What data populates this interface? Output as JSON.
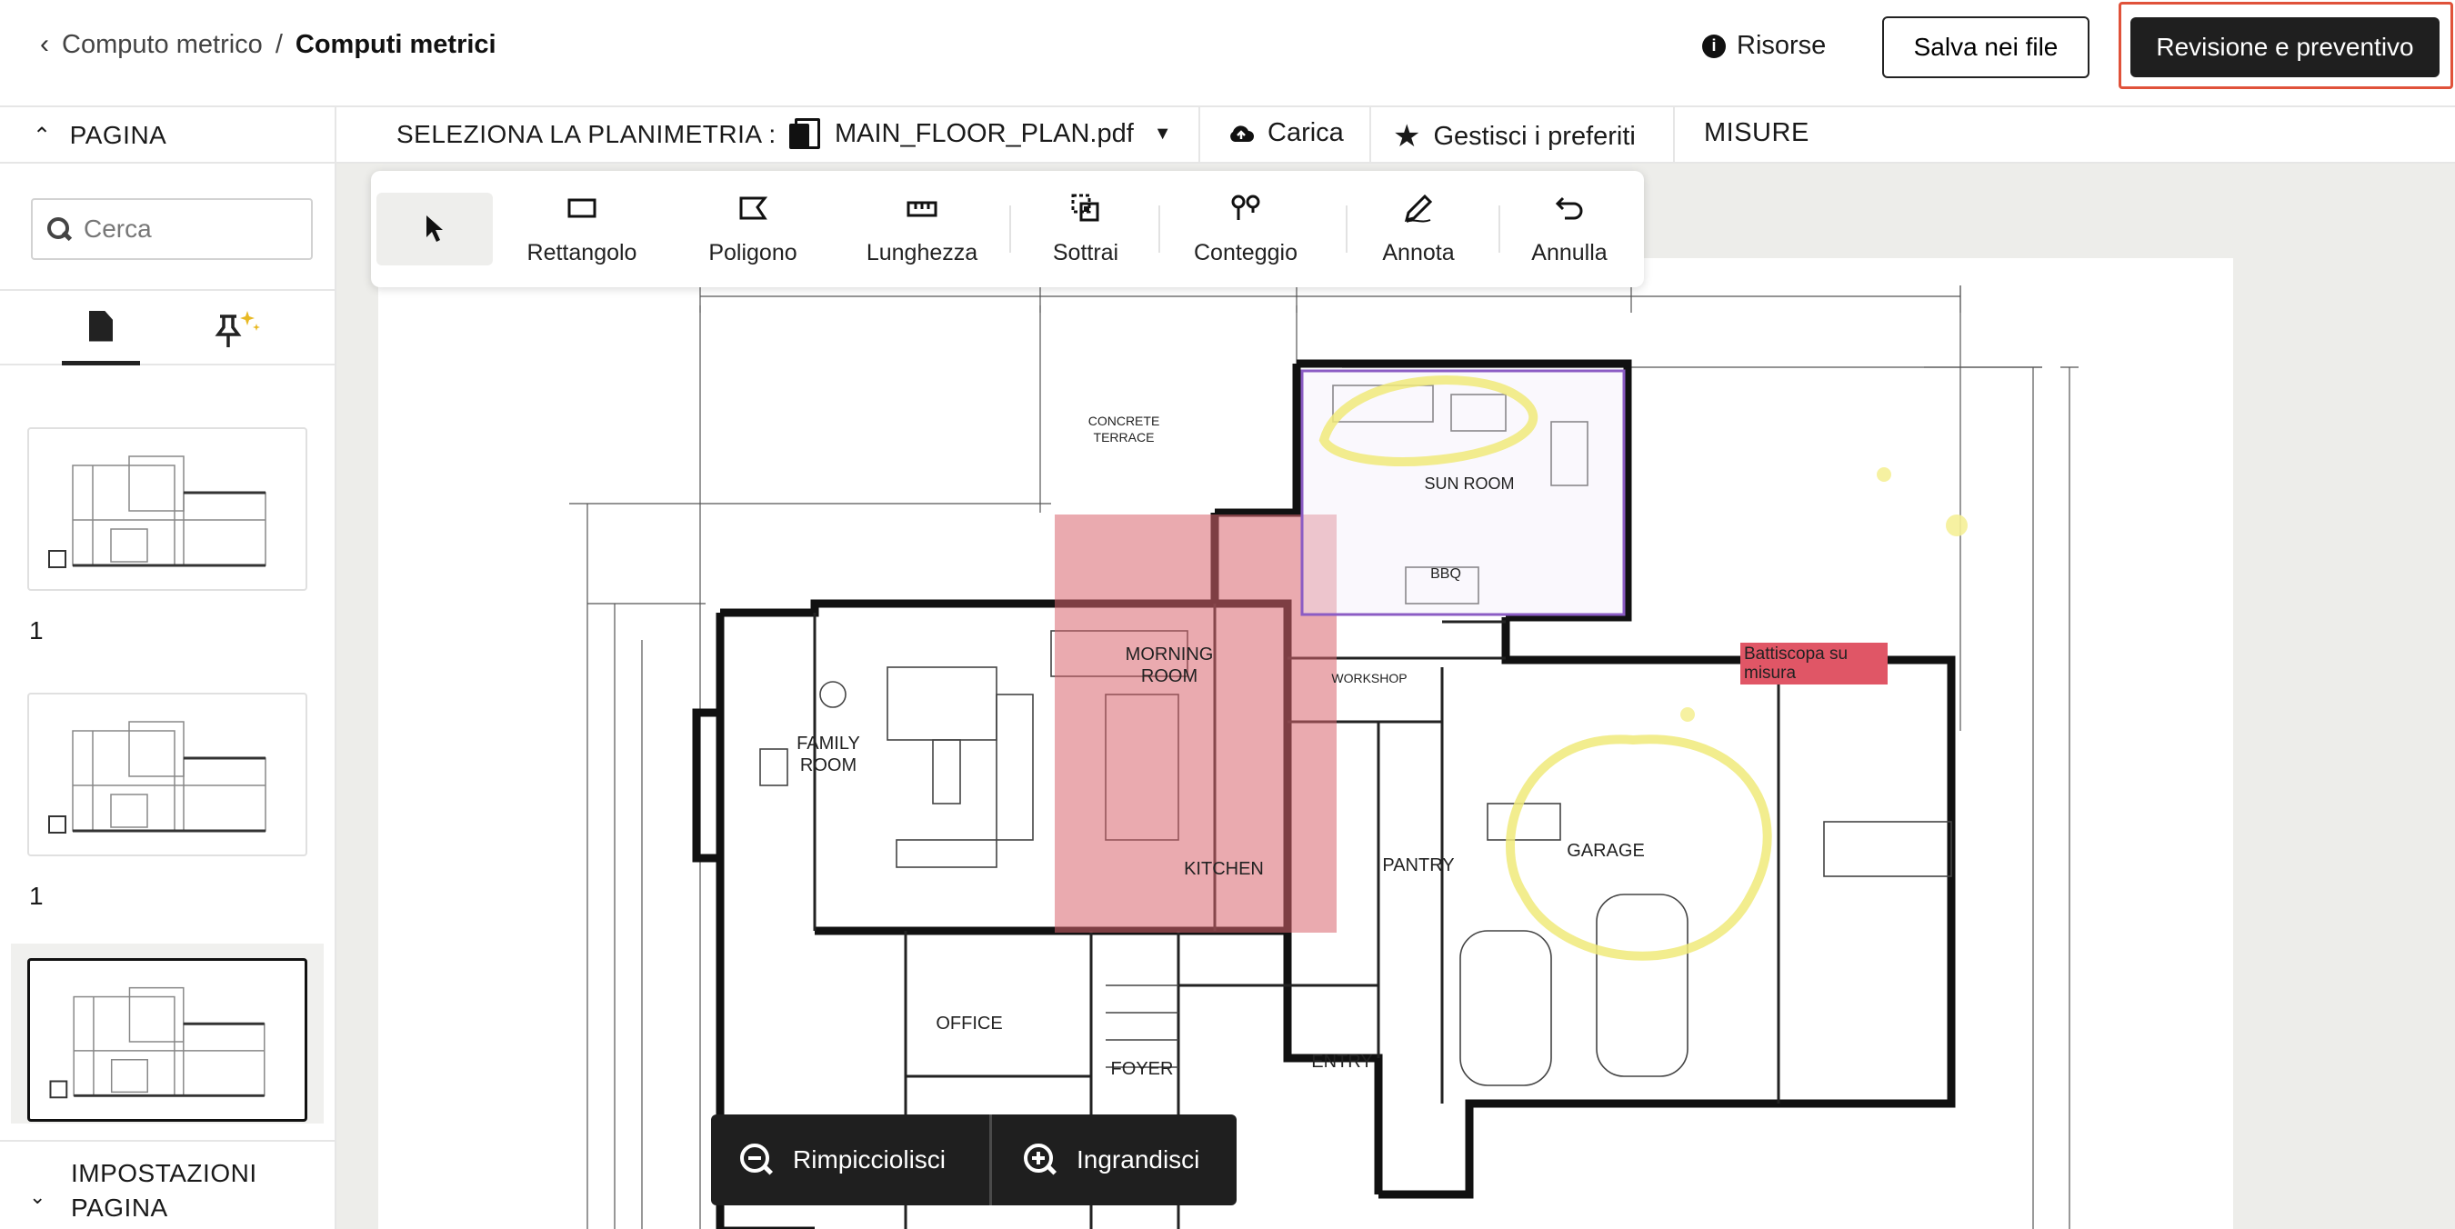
{
  "header": {
    "breadcrumb_parent": "Computo metrico",
    "breadcrumb_sep": "/",
    "breadcrumb_current": "Computi metrici",
    "resources_label": "Risorse",
    "save_label": "Salva nei file",
    "primary_label": "Revisione e preventivo"
  },
  "subbar": {
    "page_label": "PAGINA",
    "select_label": "SELEZIONA LA PLANIMETRIA :",
    "file_name": "MAIN_FLOOR_PLAN.pdf",
    "upload_label": "Carica",
    "favorites_label": "Gestisci i preferiti",
    "measures_label": "MISURE"
  },
  "sidebar": {
    "search_placeholder": "Cerca",
    "pages": [
      {
        "number": "1",
        "active": false
      },
      {
        "number": "1",
        "active": false
      },
      {
        "number": "",
        "active": true
      }
    ],
    "settings_label": "IMPOSTAZIONI PAGINA"
  },
  "toolbar": {
    "tools": [
      {
        "label": "",
        "icon": "cursor-icon"
      },
      {
        "label": "Rettangolo",
        "icon": "rectangle-icon"
      },
      {
        "label": "Poligono",
        "icon": "polygon-icon"
      },
      {
        "label": "Lunghezza",
        "icon": "ruler-icon"
      },
      {
        "label": "Sottrai",
        "icon": "subtract-icon"
      },
      {
        "label": "Conteggio",
        "icon": "count-icon"
      },
      {
        "label": "Annota",
        "icon": "pen-icon"
      },
      {
        "label": "Annulla",
        "icon": "undo-icon"
      }
    ]
  },
  "zoom": {
    "zoom_out_label": "Rimpicciolisci",
    "zoom_in_label": "Ingrandisci"
  },
  "plan": {
    "annotation_label": "Battiscopa su misura",
    "rooms": {
      "morning_room": "MORNING ROOM",
      "family_room": "FAMILY ROOM",
      "kitchen": "KITCHEN",
      "pantry": "PANTRY",
      "garage": "GARAGE",
      "office": "OFFICE",
      "foyer": "FOYER",
      "entry": "ENTRY",
      "concrete_terrace": "CONCRETE TERRACE",
      "workshop": "WORKSHOP",
      "bbq": "BBQ",
      "sun_room": "SUN ROOM"
    },
    "colors": {
      "highlight_red": "#d9646d",
      "highlight_yellow": "#f3ef9a",
      "polygon_purple": "#8b5cc4"
    }
  }
}
